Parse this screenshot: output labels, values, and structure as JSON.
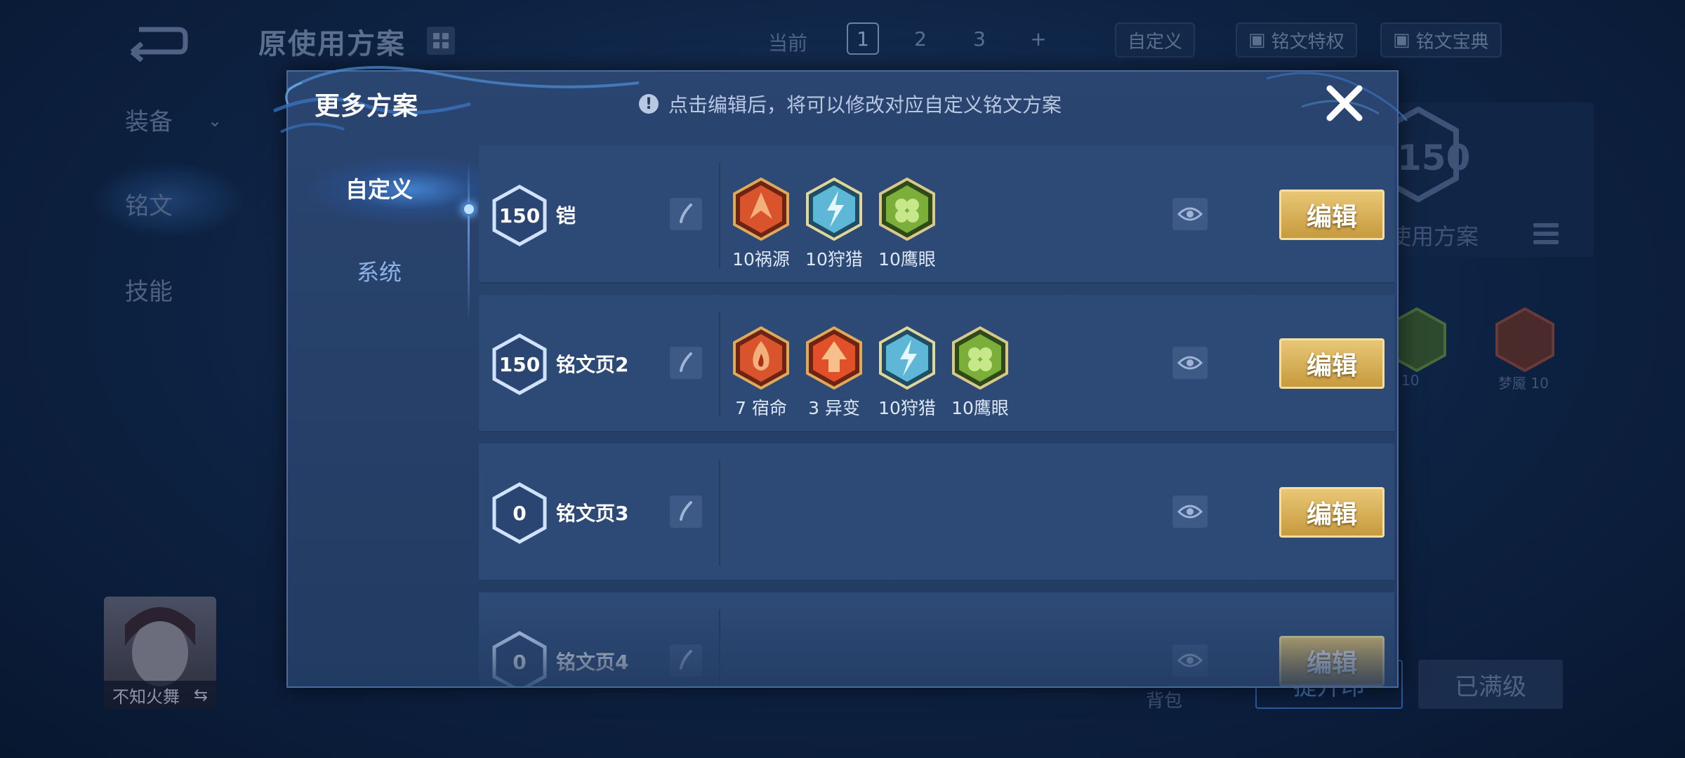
{
  "background": {
    "title": "原使用方案",
    "current_label": "当前",
    "tabs": [
      "1",
      "2",
      "3",
      "+"
    ],
    "custom_label": "自定义",
    "rune_feature_label": "铭文特权",
    "rune_book_label": "铭文宝典",
    "sidebar": [
      "装备",
      "铭文",
      "技能"
    ],
    "rune_level": "150",
    "use_plan_label": "使用方案",
    "rune_labels": [
      "10",
      "梦魇 10"
    ],
    "player_name": "不知火舞",
    "bag_label": "背包",
    "upgrade_label": "提升印",
    "maxed_label": "已满级"
  },
  "modal": {
    "title": "更多方案",
    "hint": "点击编辑后，将可以修改对应自定义铭文方案",
    "hint_icon": "!",
    "nav": [
      {
        "label": "自定义",
        "active": true
      },
      {
        "label": "系统",
        "active": false
      }
    ],
    "edit_label": "编辑",
    "pages": [
      {
        "level": "150",
        "name": "铠",
        "runes": [
          {
            "label": "10祸源",
            "icon": "rune-red-burst-icon",
            "color": "#d9542c"
          },
          {
            "label": "10狩猎",
            "icon": "rune-blue-lightning-icon",
            "color": "#5fb7d8"
          },
          {
            "label": "10鹰眼",
            "icon": "rune-green-clover-icon",
            "color": "#7cae3a"
          }
        ]
      },
      {
        "level": "150",
        "name": "铭文页2",
        "runes": [
          {
            "label": "7 宿命",
            "icon": "rune-red-flame-icon",
            "color": "#d9542c"
          },
          {
            "label": "3 异变",
            "icon": "rune-red-arrow-icon",
            "color": "#e2502a"
          },
          {
            "label": "10狩猎",
            "icon": "rune-blue-lightning-icon",
            "color": "#5fb7d8"
          },
          {
            "label": "10鹰眼",
            "icon": "rune-green-clover-icon",
            "color": "#7cae3a"
          }
        ]
      },
      {
        "level": "0",
        "name": "铭文页3",
        "runes": []
      },
      {
        "level": "0",
        "name": "铭文页4",
        "runes": []
      }
    ]
  },
  "colors": {
    "edit_button_gold": "#d4ab55",
    "panel_bg": "#223b62",
    "row_bg": "#2d4a76"
  }
}
